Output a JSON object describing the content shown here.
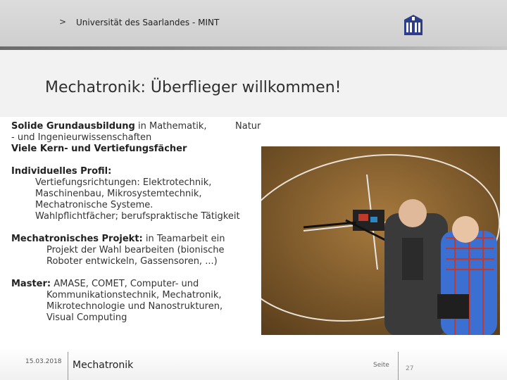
{
  "header": {
    "arrow": ">",
    "breadcrumb": "Universität des Saarlandes - MINT"
  },
  "slide": {
    "title": "Mechatronik: Überflieger willkommen!",
    "sections": {
      "s1_bold": "Solide Grundausbildung",
      "s1_rest": " in Mathematik,",
      "s1_natur": "Natur",
      "s1_line2": "- und Ingenieurwissenschaften",
      "s1_line3": "Viele Kern- und Vertiefungsfächer",
      "s2_heading": "Individuelles Profil:",
      "s2_l1": "Vertiefungsrichtungen: Elektrotechnik,",
      "s2_l2": "Maschinenbau, Mikrosystemtechnik,",
      "s2_l3": "Mechatronische Systeme.",
      "s2_l4": "Wahlpflichtfächer; berufspraktische Tätigkeit",
      "s3_bold": "Mechatronisches Projekt:",
      "s3_rest": " in Teamarbeit ein",
      "s3_l2": "Projekt der Wahl bearbeiten (bionische",
      "s3_l3": "Roboter entwickeln, Gassensoren, ...)",
      "s4_bold": "Master:",
      "s4_rest": " AMASE, COMET, Computer- und",
      "s4_l2": "Kommunikationstechnik, Mechatronik,",
      "s4_l3": "Mikrotechnologie und Nanostrukturen,",
      "s4_l4": "Visual Computing"
    }
  },
  "footer": {
    "date": "15.03.2018",
    "title": "Mechatronik",
    "page_label": "Seite",
    "page_number": "27"
  },
  "colors": {
    "header_bg": "#d6d6d6",
    "title_band": "#f2f2f2",
    "text": "#333333"
  }
}
